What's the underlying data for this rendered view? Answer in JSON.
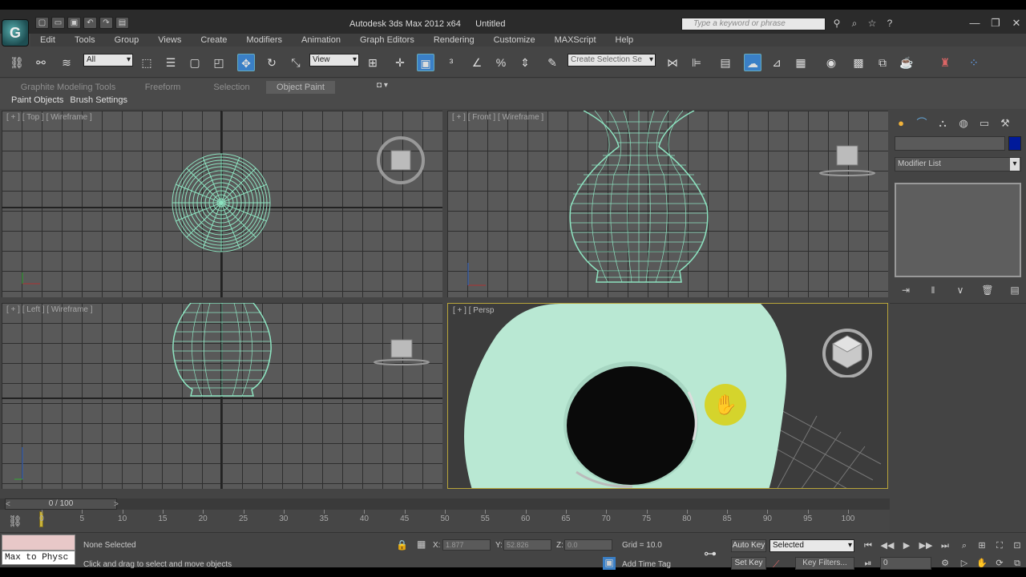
{
  "titlebar": {
    "app_title": "Autodesk 3ds Max  2012 x64",
    "file_name": "Untitled",
    "search_placeholder": "Type a keyword or phrase",
    "quick_access_icons": [
      "new-icon",
      "open-icon",
      "save-icon",
      "undo-icon",
      "redo-icon",
      "project-icon"
    ],
    "icons": [
      "binoculars-icon",
      "search-icon",
      "star-icon",
      "help-icon"
    ]
  },
  "menu": [
    "Edit",
    "Tools",
    "Group",
    "Views",
    "Create",
    "Modifiers",
    "Animation",
    "Graph Editors",
    "Rendering",
    "Customize",
    "MAXScript",
    "Help"
  ],
  "toolbar": {
    "selection_filter": "All",
    "reference_coord": "View",
    "named_selection_placeholder": "Create Selection Se"
  },
  "ribbon": {
    "tabs": [
      "Graphite Modeling Tools",
      "Freeform",
      "Selection",
      "Object Paint"
    ],
    "active_tab": "Object Paint",
    "sub_items": [
      "Paint Objects",
      "Brush Settings"
    ]
  },
  "viewports": {
    "top": "[ + ] [ Top ] [ Wireframe ]",
    "front": "[ + ] [ Front ] [ Wireframe ]",
    "left": "[ + ] [ Left ] [ Wireframe ]",
    "perspective": "[ + ] [ Persp"
  },
  "command_panel": {
    "modifier_list": "Modifier List",
    "object_color": "#001a9a",
    "tab_icons": [
      "create-icon",
      "modify-icon",
      "hierarchy-icon",
      "motion-icon",
      "display-icon",
      "utilities-icon"
    ]
  },
  "timeslider": {
    "frame": "0 / 100",
    "prev": "<",
    "next": ">"
  },
  "trackbar": {
    "ticks": [
      "0",
      "5",
      "10",
      "15",
      "20",
      "25",
      "30",
      "35",
      "40",
      "45",
      "50",
      "55",
      "60",
      "65",
      "70",
      "75",
      "80",
      "85",
      "90",
      "95",
      "100"
    ]
  },
  "status": {
    "maxscript_listener": "Max to Physc",
    "selection": "None Selected",
    "prompt": "Click and drag to select and move objects",
    "x_label": "X:",
    "x_value": "1.877",
    "y_label": "Y:",
    "y_value": "52.826",
    "z_label": "Z:",
    "z_value": "0.0",
    "grid": "Grid = 10.0",
    "add_time_tag": "Add Time Tag",
    "auto_key": "Auto Key",
    "set_key": "Set Key",
    "key_mode": "Selected",
    "key_filters": "Key Filters...",
    "current_frame": "0"
  }
}
